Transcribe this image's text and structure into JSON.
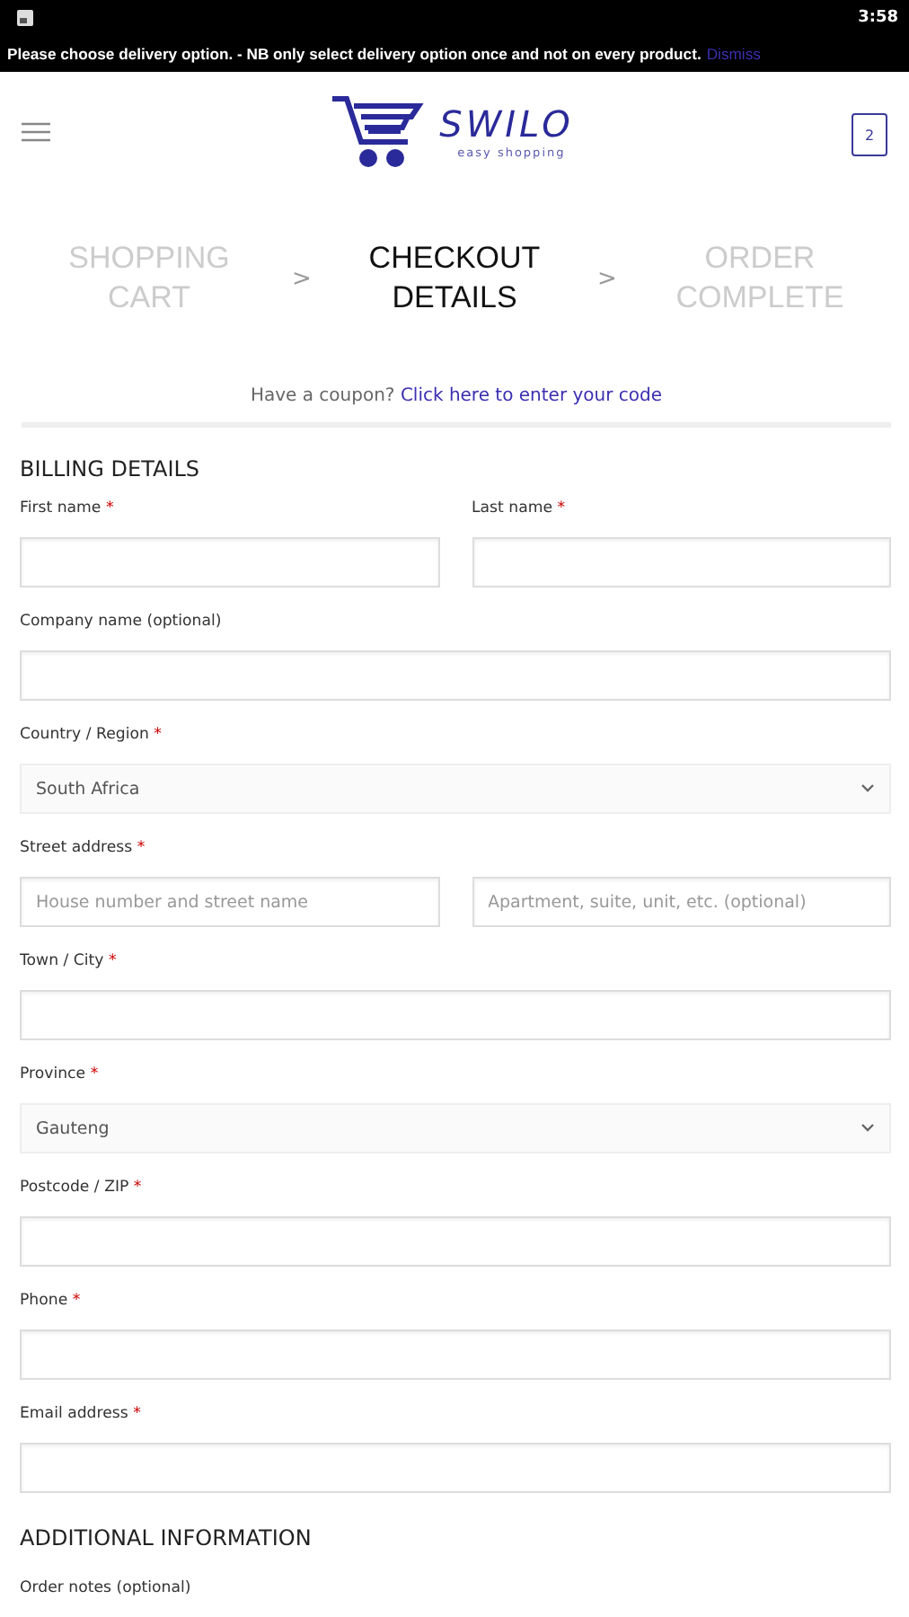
{
  "status_bar": {
    "time": "3:58"
  },
  "notice": {
    "text": "Please choose delivery option. - NB only select delivery option once and not on every product.",
    "link": "Dismiss"
  },
  "header": {
    "logo": {
      "name": "SWILO",
      "tagline": "easy shopping"
    },
    "cart_count": "2"
  },
  "steps": [
    {
      "label": "SHOPPING CART",
      "selected": false
    },
    {
      "label": "CHECKOUT DETAILS",
      "selected": true
    },
    {
      "label": "ORDER COMPLETE",
      "selected": false
    }
  ],
  "step_separator": ">",
  "coupon": {
    "text": "Have a coupon?",
    "link": "Click here to enter your code"
  },
  "billing": {
    "title": "BILLING DETAILS",
    "rows": [
      {
        "fields": [
          {
            "kind": "input",
            "label": "First name",
            "mark": "*"
          },
          {
            "kind": "input",
            "label": "Last name",
            "mark": "*"
          }
        ]
      },
      {
        "fields": [
          {
            "kind": "input",
            "label": "Company name (optional)"
          }
        ]
      },
      {
        "fields": [
          {
            "kind": "select",
            "label": "Country / Region",
            "mark": "*",
            "value": "South Africa"
          }
        ]
      },
      {
        "fields": [
          {
            "kind": "input",
            "label": "Street address",
            "mark": "*",
            "placeholder": "House number and street name"
          },
          {
            "kind": "input",
            "placeholder": "Apartment, suite, unit, etc. (optional)"
          }
        ]
      },
      {
        "fields": [
          {
            "kind": "input",
            "label": "Town / City",
            "mark": "*"
          }
        ]
      },
      {
        "fields": [
          {
            "kind": "select",
            "label": "Province",
            "mark": "*",
            "value": "Gauteng"
          }
        ]
      },
      {
        "fields": [
          {
            "kind": "input",
            "label": "Postcode / ZIP",
            "mark": "*"
          }
        ]
      },
      {
        "fields": [
          {
            "kind": "input",
            "label": "Phone",
            "mark": "*"
          }
        ]
      },
      {
        "fields": [
          {
            "kind": "input",
            "label": "Email address",
            "mark": "*"
          }
        ]
      }
    ]
  },
  "additional": {
    "title": "ADDITIONAL INFORMATION",
    "label": "Order notes (optional)"
  }
}
